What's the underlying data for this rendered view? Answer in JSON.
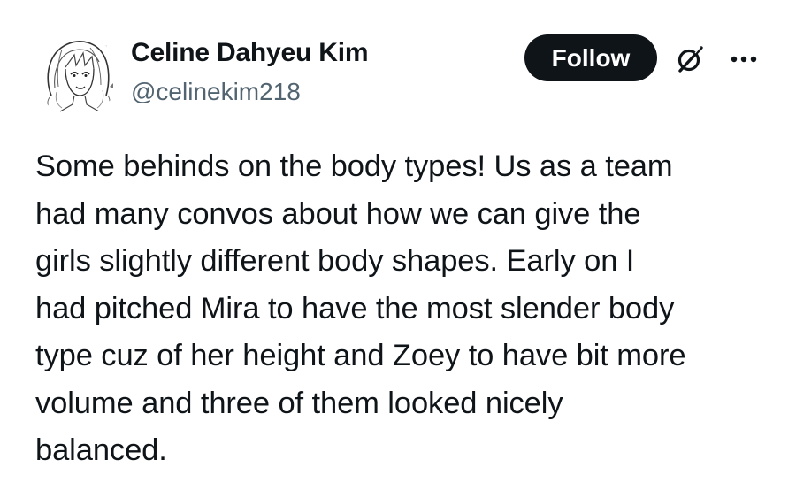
{
  "author": {
    "display_name": "Celine Dahyeu Kim",
    "handle": "@celinekim218",
    "avatar_icon": "sketch-portrait-avatar"
  },
  "actions": {
    "follow_label": "Follow",
    "grok_icon": "grok-icon",
    "more_icon": "more-options-icon"
  },
  "tweet": {
    "text": "Some behinds on the body types! Us as a team\nhad many convos about how we can give the\ngirls slightly different body shapes. Early on I\nhad pitched Mira to have the most slender body\ntype cuz of her height and Zoey to have bit more\nvolume and three of them looked nicely\nbalanced."
  },
  "colors": {
    "text_primary": "#0f1419",
    "text_secondary": "#536471",
    "button_bg": "#0f1419",
    "button_text": "#ffffff",
    "background": "#ffffff"
  }
}
